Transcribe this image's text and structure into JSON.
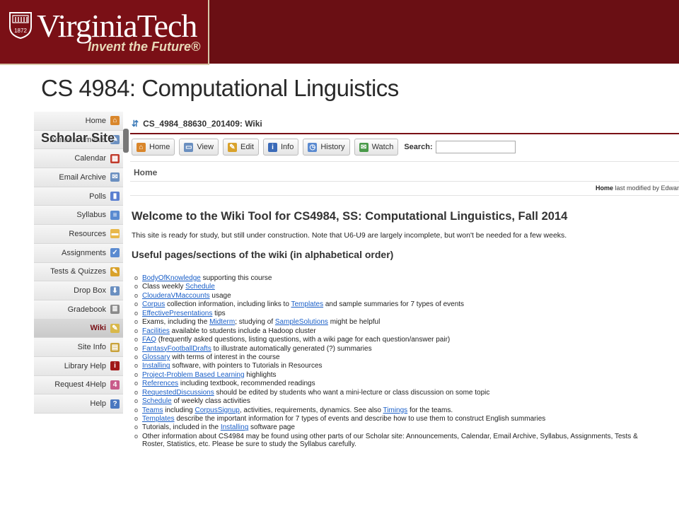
{
  "banner": {
    "wordmark": "VirginiaTech",
    "tagline": "Invent the Future®",
    "shield_year": "1872",
    "colors": {
      "maroon": "#6a0f14",
      "logo_bg": "#7a1016",
      "tagline": "#e8d9b8"
    }
  },
  "slide_title": "CS 4984: Computational Linguistics",
  "overlay_label": "Scholar Site",
  "nav": {
    "items": [
      {
        "label": "Home",
        "icon": "home-icon"
      },
      {
        "label": "Announcements",
        "icon": "announcements-icon"
      },
      {
        "label": "Calendar",
        "icon": "calendar-icon"
      },
      {
        "label": "Email Archive",
        "icon": "email-icon"
      },
      {
        "label": "Polls",
        "icon": "polls-icon"
      },
      {
        "label": "Syllabus",
        "icon": "syllabus-icon"
      },
      {
        "label": "Resources",
        "icon": "folder-icon"
      },
      {
        "label": "Assignments",
        "icon": "assignments-icon"
      },
      {
        "label": "Tests & Quizzes",
        "icon": "pencil-icon"
      },
      {
        "label": "Drop Box",
        "icon": "dropbox-icon"
      },
      {
        "label": "Gradebook",
        "icon": "gradebook-icon"
      },
      {
        "label": "Wiki",
        "icon": "wiki-icon",
        "active": true
      },
      {
        "label": "Site Info",
        "icon": "site-info-icon"
      },
      {
        "label": "Library Help",
        "icon": "library-help-icon"
      },
      {
        "label": "Request 4Help",
        "icon": "request-help-icon"
      },
      {
        "label": "Help",
        "icon": "help-icon"
      }
    ]
  },
  "tool": {
    "title": "CS_4984_88630_201409: Wiki",
    "toolbar": {
      "buttons": [
        {
          "label": "Home",
          "icon": "home-icon"
        },
        {
          "label": "View",
          "icon": "view-icon"
        },
        {
          "label": "Edit",
          "icon": "edit-icon"
        },
        {
          "label": "Info",
          "icon": "info-icon"
        },
        {
          "label": "History",
          "icon": "history-icon"
        },
        {
          "label": "Watch",
          "icon": "watch-icon"
        }
      ],
      "search_label": "Search:",
      "search_value": ""
    },
    "breadcrumb": "Home",
    "modified": {
      "page": "Home",
      "text": " last modified by Edwar"
    }
  },
  "content": {
    "heading": "Welcome to the Wiki Tool for CS4984, SS: Computational Linguistics, Fall 2014",
    "intro": "This site is ready for study, but still under construction. Note that U6-U9 are largely incomplete, but won't be needed for a few weeks.",
    "subheading": "Useful pages/sections of the wiki (in alphabetical order)",
    "items": [
      [
        {
          "link": "BodyOfKnowledge"
        },
        {
          "text": " supporting this course"
        }
      ],
      [
        {
          "text": "Class weekly "
        },
        {
          "link": "Schedule"
        }
      ],
      [
        {
          "link": "ClouderaVMaccounts"
        },
        {
          "text": " usage"
        }
      ],
      [
        {
          "link": "Corpus"
        },
        {
          "text": " collection information, including links to "
        },
        {
          "link": "Templates"
        },
        {
          "text": " and sample summaries for 7 types of events"
        }
      ],
      [
        {
          "link": "EffectivePresentations"
        },
        {
          "text": " tips"
        }
      ],
      [
        {
          "text": "Exams, including the "
        },
        {
          "link": "Midterm"
        },
        {
          "text": "; studying of "
        },
        {
          "link": "SampleSolutions"
        },
        {
          "text": " might be helpful"
        }
      ],
      [
        {
          "link": "Facilities"
        },
        {
          "text": " available to students include a Hadoop cluster"
        }
      ],
      [
        {
          "link": "FAQ"
        },
        {
          "text": " (frequently asked questions, listing questions, with a wiki page for each question/answer pair)"
        }
      ],
      [
        {
          "link": "FantasyFootballDrafts"
        },
        {
          "text": " to illustrate automatically generated (?) summaries"
        }
      ],
      [
        {
          "link": "Glossary"
        },
        {
          "text": " with terms of interest in the course"
        }
      ],
      [
        {
          "link": "Installing"
        },
        {
          "text": " software, with pointers to Tutorials in Resources"
        }
      ],
      [
        {
          "link": "Project-Problem Based Learning"
        },
        {
          "text": " highlights"
        }
      ],
      [
        {
          "link": "References"
        },
        {
          "text": " including textbook, recommended readings"
        }
      ],
      [
        {
          "link": "RequestedDiscussions"
        },
        {
          "text": " should be edited by students who want a mini-lecture or class discussion on some topic"
        }
      ],
      [
        {
          "link": "Schedule"
        },
        {
          "text": " of weekly class activities"
        }
      ],
      [
        {
          "link": "Teams"
        },
        {
          "text": " including "
        },
        {
          "link": "CorpusSignup"
        },
        {
          "text": ", activities, requirements, dynamics. See also "
        },
        {
          "link": "Timings"
        },
        {
          "text": " for the teams."
        }
      ],
      [
        {
          "link": "Templates"
        },
        {
          "text": " describe the important information for 7 types of events and describe how to use them to construct English summaries"
        }
      ],
      [
        {
          "text": "Tutorials, included in the "
        },
        {
          "link": "Installing"
        },
        {
          "text": " software page"
        }
      ],
      [
        {
          "text": "Other information about CS4984 may be found using other parts of our Scholar site: Announcements, Calendar, Email Archive, Syllabus, Assignments, Tests &"
        }
      ]
    ],
    "continuation": "Roster, Statistics, etc. Please be sure to study the Syllabus carefully."
  }
}
